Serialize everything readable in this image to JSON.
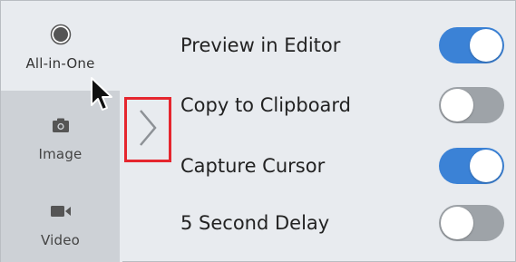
{
  "modes": [
    {
      "label": "All-in-One",
      "icon": "record-circle-icon",
      "active": true
    },
    {
      "label": "Image",
      "icon": "camera-icon",
      "active": false
    },
    {
      "label": "Video",
      "icon": "video-camera-icon",
      "active": false
    }
  ],
  "expand_toggle": {
    "icon": "chevron-right-icon",
    "highlight_color": "#e5262e"
  },
  "settings": [
    {
      "label": "Preview in Editor",
      "on": true
    },
    {
      "label": "Copy to Clipboard",
      "on": false
    },
    {
      "label": "Capture Cursor",
      "on": true
    },
    {
      "label": "5 Second Delay",
      "on": false
    }
  ],
  "colors": {
    "toggle_on": "#3b82d6",
    "toggle_off": "#9ea3a8",
    "sidebar_inactive": "#cdd1d6"
  }
}
